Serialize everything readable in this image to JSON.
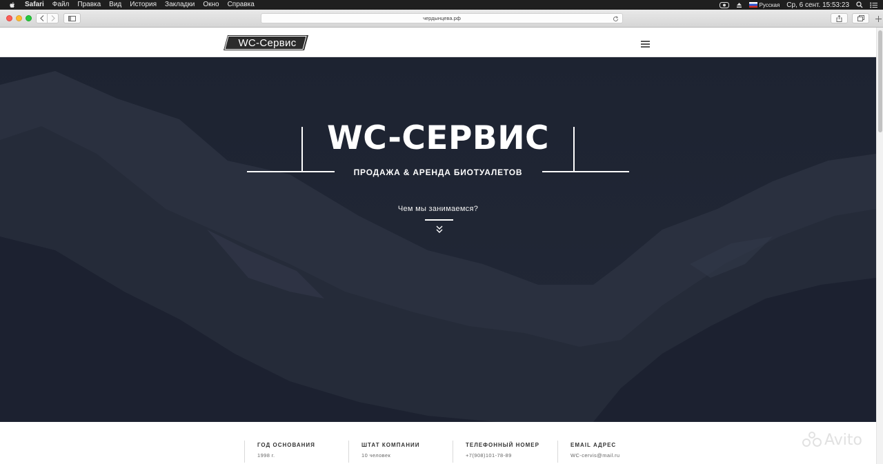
{
  "menubar": {
    "app": "Safari",
    "items": [
      "Файл",
      "Правка",
      "Вид",
      "История",
      "Закладки",
      "Окно",
      "Справка"
    ],
    "language": "Русская",
    "datetime": "Ср, 6 сент.  15:53:23"
  },
  "browser": {
    "url": "чердынцева.рф"
  },
  "site": {
    "logo": "WC-Сервис",
    "hero": {
      "title": "WC-СЕРВИС",
      "subtitle": "ПРОДАЖА & АРЕНДА БИОТУАЛЕТОВ",
      "link": "Чем мы занимаемся?"
    },
    "info": [
      {
        "label": "ГОД ОСНОВАНИЯ",
        "value": "1998 г."
      },
      {
        "label": "ШТАТ КОМПАНИИ",
        "value": "10 человек"
      },
      {
        "label": "ТЕЛЕФОННЫЙ НОМЕР",
        "value": "+7(908)101-78-89"
      },
      {
        "label": "EMAIL АДРЕС",
        "value": "WC-cervis@mail.ru"
      }
    ]
  },
  "watermark": "Avito",
  "colors": {
    "hero_bg": "#202634",
    "logo_bg": "#2b2b2b",
    "menubar_bg": "#1f1f1f"
  },
  "icons": [
    "apple-icon",
    "back-icon",
    "forward-icon",
    "sidebar-icon",
    "reload-icon",
    "share-icon",
    "tabs-icon",
    "new-tab-icon",
    "hamburger-icon",
    "double-chevron-down-icon",
    "search-icon",
    "notification-list-icon",
    "eject-icon",
    "flag-icon"
  ]
}
